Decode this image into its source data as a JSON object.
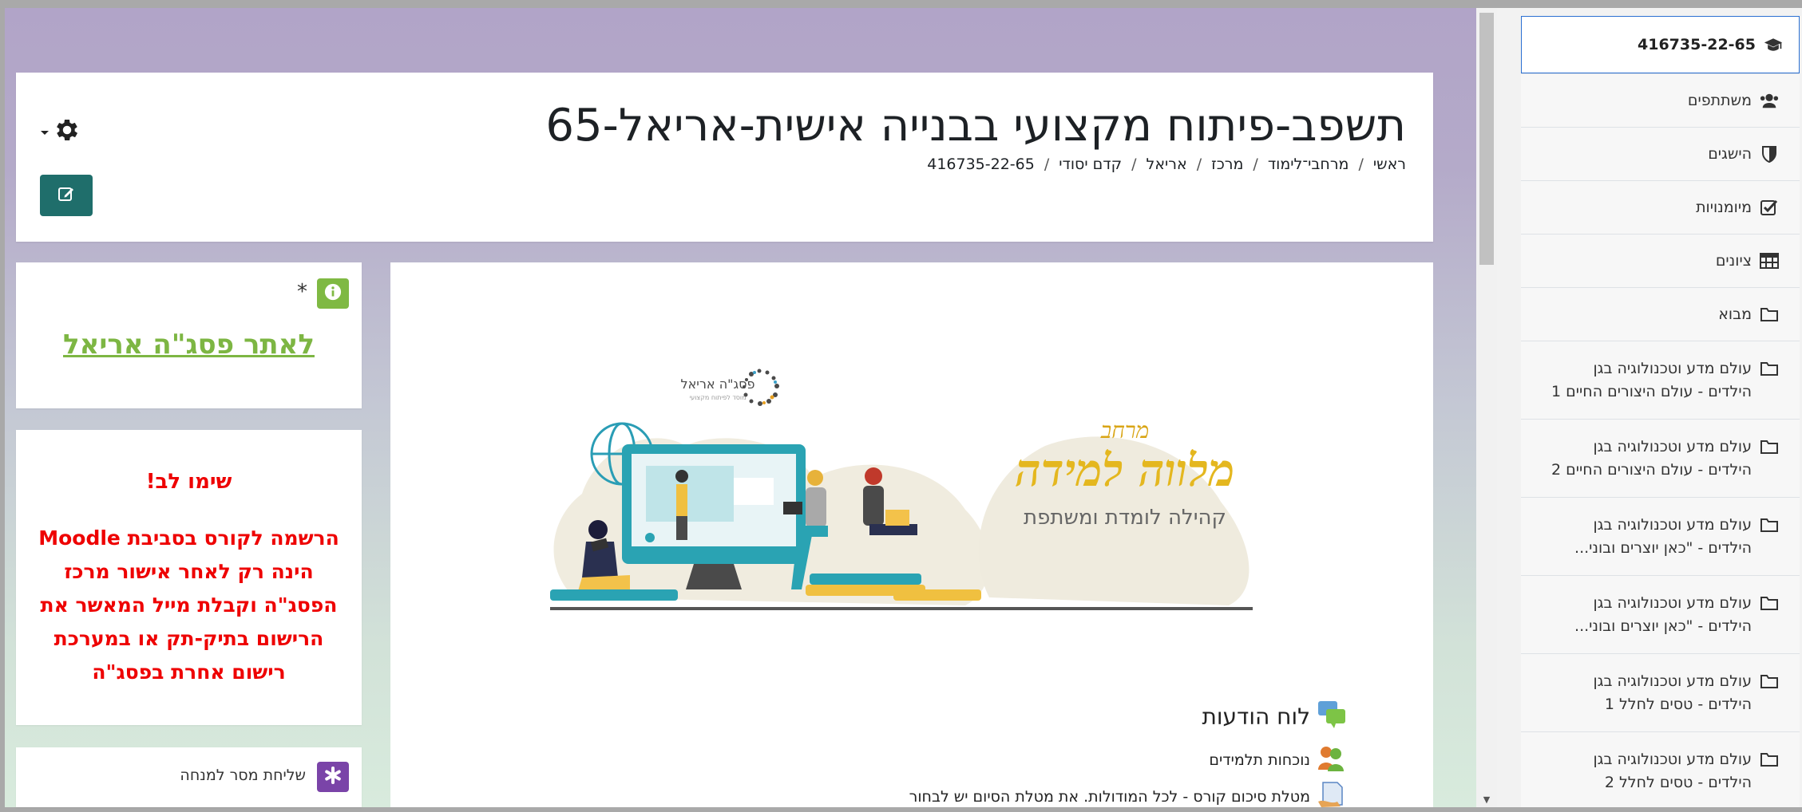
{
  "header": {
    "title": "תשפב-פיתוח מקצועי בבנייה אישית-אריאל-65",
    "breadcrumb": [
      "ראשי",
      "מרחבי־לימוד",
      "מרכז",
      "אריאל",
      "קדם יסודי",
      "416735-22-65"
    ],
    "breadcrumb_sep": "/"
  },
  "nav": {
    "course_code": "416735-22-65",
    "items": [
      {
        "label": "משתתפים",
        "icon": "users-icon"
      },
      {
        "label": "הישגים",
        "icon": "shield-icon"
      },
      {
        "label": "מיומנויות",
        "icon": "checkbox-icon"
      },
      {
        "label": "ציונים",
        "icon": "table-icon"
      },
      {
        "label": "מבוא",
        "icon": "folder-icon"
      },
      {
        "label": "עולם מדע וטכנולוגיה בגן הילדים - עולם היצורים החיים 1",
        "icon": "folder-icon"
      },
      {
        "label": "עולם מדע וטכנולוגיה בגן הילדים - עולם היצורים החיים 2",
        "icon": "folder-icon"
      },
      {
        "label": "עולם מדע וטכנולוגיה בגן הילדים - \"כאן יוצרים ובוני...",
        "icon": "folder-icon"
      },
      {
        "label": "עולם מדע וטכנולוגיה בגן הילדים - \"כאן יוצרים ובוני...",
        "icon": "folder-icon"
      },
      {
        "label": "עולם מדע וטכנולוגיה בגן הילדים - טסים לחלל 1",
        "icon": "folder-icon"
      },
      {
        "label": "עולם מדע וטכנולוגיה בגן הילדים - טסים לחלל 2",
        "icon": "folder-icon"
      }
    ]
  },
  "blocks": {
    "site_link": {
      "asterisk": "*",
      "label": "לאתר פסג\"ה אריאל"
    },
    "notice": {
      "title": "שימו לב!",
      "lines": [
        "הרשמה לקורס בסביבת Moodle",
        "הינה רק לאחר אישור מרכז",
        "הפסג\"ה וקבלת מייל המאשר את",
        "הרישום בתיק-תק או במערכת",
        "רישום אחרת בפסג\"ה"
      ]
    },
    "message": {
      "label": "שליחת מסר למנחה"
    }
  },
  "banner": {
    "logo_text": "פסג\"ה אריאל",
    "logo_sub": "מוסד לפיתוח מקצועי",
    "title_top": "מרחב",
    "title_main": "מלווה למידה",
    "subtitle": "קהילה  לומדת  ומשתפת"
  },
  "activities": {
    "forum": "לוח הודעות",
    "attendance": "נוכחות תלמידים",
    "summary": "מטלת סיכום קורס - לכל המודולות. את מטלת הסיום יש לבחור"
  },
  "colors": {
    "accent": "#1f6e6b",
    "link_green": "#7db643",
    "notice_red": "#ee0000",
    "active_border": "#2a6fd1",
    "message_purple": "#7a44a8"
  }
}
